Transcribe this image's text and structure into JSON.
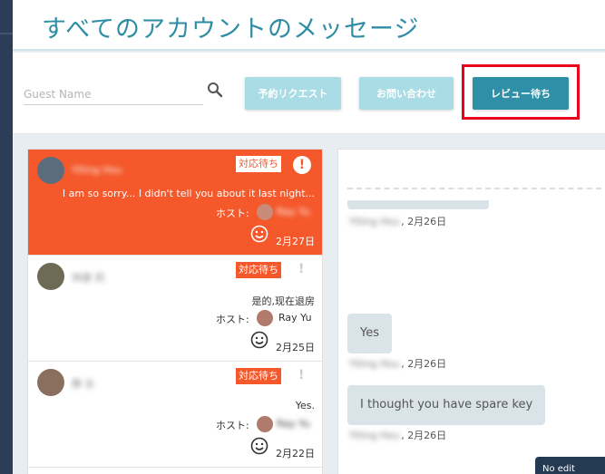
{
  "header": {
    "title": "すべてのアカウントのメッセージ"
  },
  "search": {
    "placeholder": "Guest Name"
  },
  "filters": {
    "request_label": "予約リクエスト",
    "inquiry_label": "お問い合わせ",
    "review_label": "レビュー待ち"
  },
  "conversations": [
    {
      "guest": "Yiting Hsu",
      "status": "対応待ち",
      "preview": "I am so sorry... I didn't tell you about it last night...",
      "host_label": "ホスト:",
      "host": "Ray Yu",
      "date": "2月27日"
    },
    {
      "guest": "林建 凯",
      "status": "対応待ち",
      "preview": "是的,现在退房",
      "host_label": "ホスト:",
      "host": "Ray Yu",
      "date": "2月25日"
    },
    {
      "guest": "静 女",
      "status": "対応待ち",
      "preview": "Yes.",
      "host_label": "ホスト:",
      "host": "Ray Yu",
      "date": "2月22日"
    }
  ],
  "chat": {
    "messages": [
      {
        "text": "",
        "sender": "Yiting Hsu",
        "date": "2月26日"
      },
      {
        "text": "Yes",
        "sender": "Yiting Hsu",
        "date": "2月26日"
      },
      {
        "text": "I thought you have spare key",
        "sender": "Yiting Hsu",
        "date": "2月26日"
      }
    ],
    "button_label": "No edit"
  },
  "colors": {
    "accent": "#2e8fa6",
    "active_item": "#f4582b",
    "highlight": "#e8001c",
    "title": "#2f8ea4"
  }
}
